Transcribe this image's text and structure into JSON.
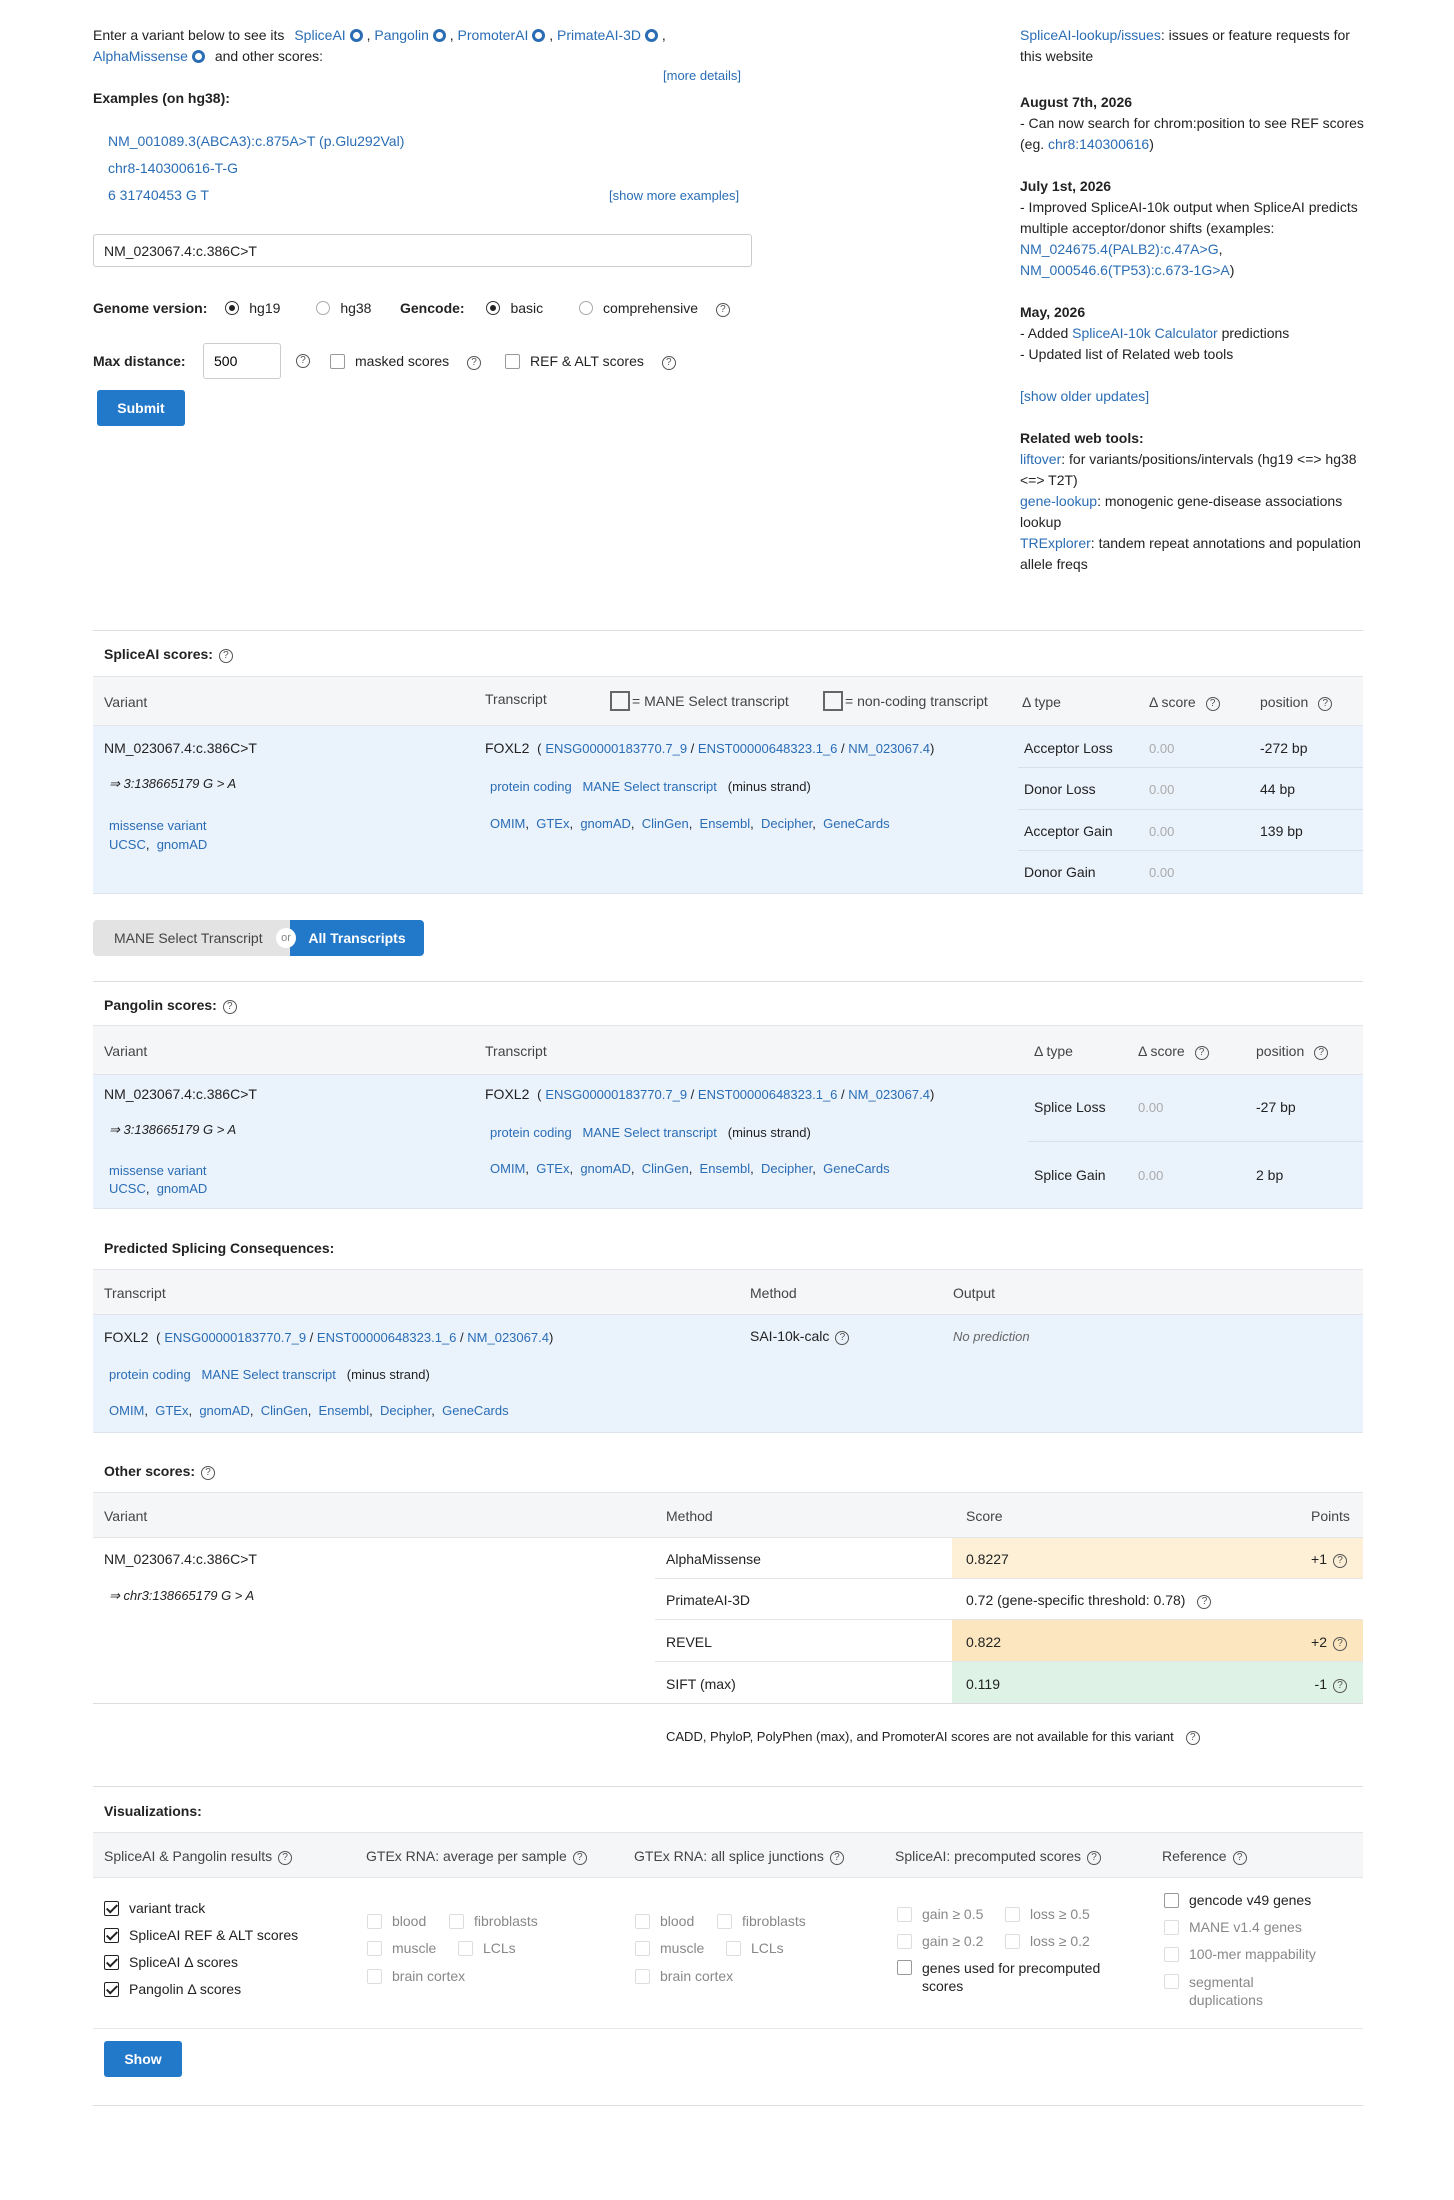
{
  "intro": {
    "prefix": "Enter a variant below to see its",
    "tools": [
      "SpliceAI",
      "Pangolin",
      "PromoterAI",
      "PrimateAI-3D",
      "AlphaMissense"
    ],
    "suffix": "and other scores:",
    "more_details": "[more details]",
    "examples_title": "Examples  (on hg38):",
    "examples": [
      "NM_001089.3(ABCA3):c.875A>T (p.Glu292Val)",
      "chr8-140300616-T-G",
      "6  31740453  G  T"
    ],
    "show_more": "[show more examples]"
  },
  "search": {
    "value": "NM_023067.4:c.386C>T"
  },
  "options": {
    "genome_label": "Genome version:",
    "genome_opts": [
      "hg19",
      "hg38"
    ],
    "gencode_label": "Gencode:",
    "gencode_opts": [
      "basic",
      "comprehensive"
    ],
    "maxdist_label": "Max distance:",
    "maxdist_value": "500",
    "masked_label": "masked scores",
    "refalt_label": "REF & ALT scores",
    "submit": "Submit"
  },
  "news": {
    "issues_link": "SpliceAI-lookup/issues",
    "issues_text": ": issues or feature requests for this website",
    "u1_date": "August 7th, 2026",
    "u1_text": "- Can now search for chrom:position to see REF scores (eg.",
    "u1_link": "chr8:140300616",
    "u1_end": ")",
    "u2_date": "July 1st, 2026",
    "u2_text": "- Improved SpliceAI-10k output when SpliceAI predicts multiple acceptor/donor shifts (examples:",
    "u2_link1": "NM_024675.4(PALB2):c.47A>G",
    "u2_link2": "NM_000546.6(TP53):c.673-1G>A",
    "u2_end": ")",
    "u3_date": "May, 2026",
    "u3_pre": "- Added",
    "u3_link": "SpliceAI-10k Calculator",
    "u3_post": "predictions",
    "u3_line2": "- Updated list of Related web tools",
    "show_older": "[show older updates]",
    "related_title": "Related web tools:",
    "r1_link": "liftover",
    "r1_text": ": for variants/positions/intervals (hg19 <=> hg38 <=> T2T)",
    "r2_link": "gene-lookup",
    "r2_text": ": monogenic gene-disease associations lookup",
    "r3_link": "TRExplorer",
    "r3_text": ": tandem repeat annotations and population allele freqs"
  },
  "spliceai": {
    "title": "SpliceAI scores:",
    "h_variant": "Variant",
    "h_transcript": "Transcript",
    "legend_mane": "= MANE Select transcript",
    "legend_noncoding": "= non-coding transcript",
    "h_type": "Δ type",
    "h_score": "Δ score",
    "h_position": "position",
    "variant": "NM_023067.4:c.386C>T",
    "variant_arrow": "⇒ 3:138665179 G > A",
    "consequence": "missense variant",
    "ucsc": "UCSC",
    "gnomad": "gnomAD",
    "gene": "FOXL2",
    "ensg": "ENSG00000183770.7_9",
    "enst": "ENST00000648323.1_6",
    "nm": "NM_023067.4",
    "protein_coding": "protein coding",
    "mane": "MANE Select transcript",
    "strand": "(minus strand)",
    "links": [
      "OMIM",
      "GTEx",
      "gnomAD",
      "ClinGen",
      "Ensembl",
      "Decipher",
      "GeneCards"
    ],
    "rows": [
      {
        "type": "Acceptor Loss",
        "score": "0.00",
        "pos": "-272 bp"
      },
      {
        "type": "Donor Loss",
        "score": "0.00",
        "pos": "44 bp"
      },
      {
        "type": "Acceptor Gain",
        "score": "0.00",
        "pos": "139 bp"
      },
      {
        "type": "Donor Gain",
        "score": "0.00",
        "pos": ""
      }
    ]
  },
  "toggle": {
    "left": "MANE Select Transcript",
    "or": "or",
    "right": "All Transcripts"
  },
  "pangolin": {
    "title": "Pangolin scores:",
    "h_variant": "Variant",
    "h_transcript": "Transcript",
    "h_type": "Δ type",
    "h_score": "Δ score",
    "h_position": "position",
    "rows": [
      {
        "type": "Splice Loss",
        "score": "0.00",
        "pos": "-27 bp"
      },
      {
        "type": "Splice Gain",
        "score": "0.00",
        "pos": "2 bp"
      }
    ]
  },
  "psc": {
    "title": "Predicted Splicing Consequences:",
    "h_transcript": "Transcript",
    "h_method": "Method",
    "h_output": "Output",
    "method": "SAI-10k-calc",
    "output": "No prediction"
  },
  "other": {
    "title": "Other scores:",
    "h_variant": "Variant",
    "h_method": "Method",
    "h_score": "Score",
    "h_points": "Points",
    "variant_arrow": "⇒ chr3:138665179 G > A",
    "rows": [
      {
        "method": "AlphaMissense",
        "score": "0.8227",
        "points": "+1",
        "color": "#fdf0d6"
      },
      {
        "method": "PrimateAI-3D",
        "score": "0.72  (gene-specific threshold: 0.78)",
        "points": "",
        "color": "#ffffff"
      },
      {
        "method": "REVEL",
        "score": "0.822",
        "points": "+2",
        "color": "#fbe6bf"
      },
      {
        "method": "SIFT (max)",
        "score": "0.119",
        "points": "-1",
        "color": "#dff2e6"
      }
    ],
    "note": "CADD,  PhyloP,  PolyPhen (max),  and PromoterAI scores are not available for this variant"
  },
  "vis": {
    "title": "Visualizations:",
    "h1": "SpliceAI & Pangolin results",
    "h2": "GTEx RNA: average per sample",
    "h3": "GTEx RNA: all splice junctions",
    "h4": "SpliceAI: precomputed scores",
    "h5": "Reference",
    "c1": [
      "variant track",
      "SpliceAI REF & ALT scores",
      "SpliceAI Δ  scores",
      "Pangolin Δ  scores"
    ],
    "tissues": [
      "blood",
      "fibroblasts",
      "muscle",
      "LCLs",
      "brain cortex"
    ],
    "pre": [
      "gain ≥ 0.5",
      "loss ≥ 0.5",
      "gain ≥ 0.2",
      "loss ≥ 0.2"
    ],
    "pre_genes": "genes used for precomputed scores",
    "ref": [
      "gencode v49 genes",
      "MANE v1.4 genes",
      "100-mer mappability",
      "segmental duplications"
    ],
    "show": "Show"
  }
}
